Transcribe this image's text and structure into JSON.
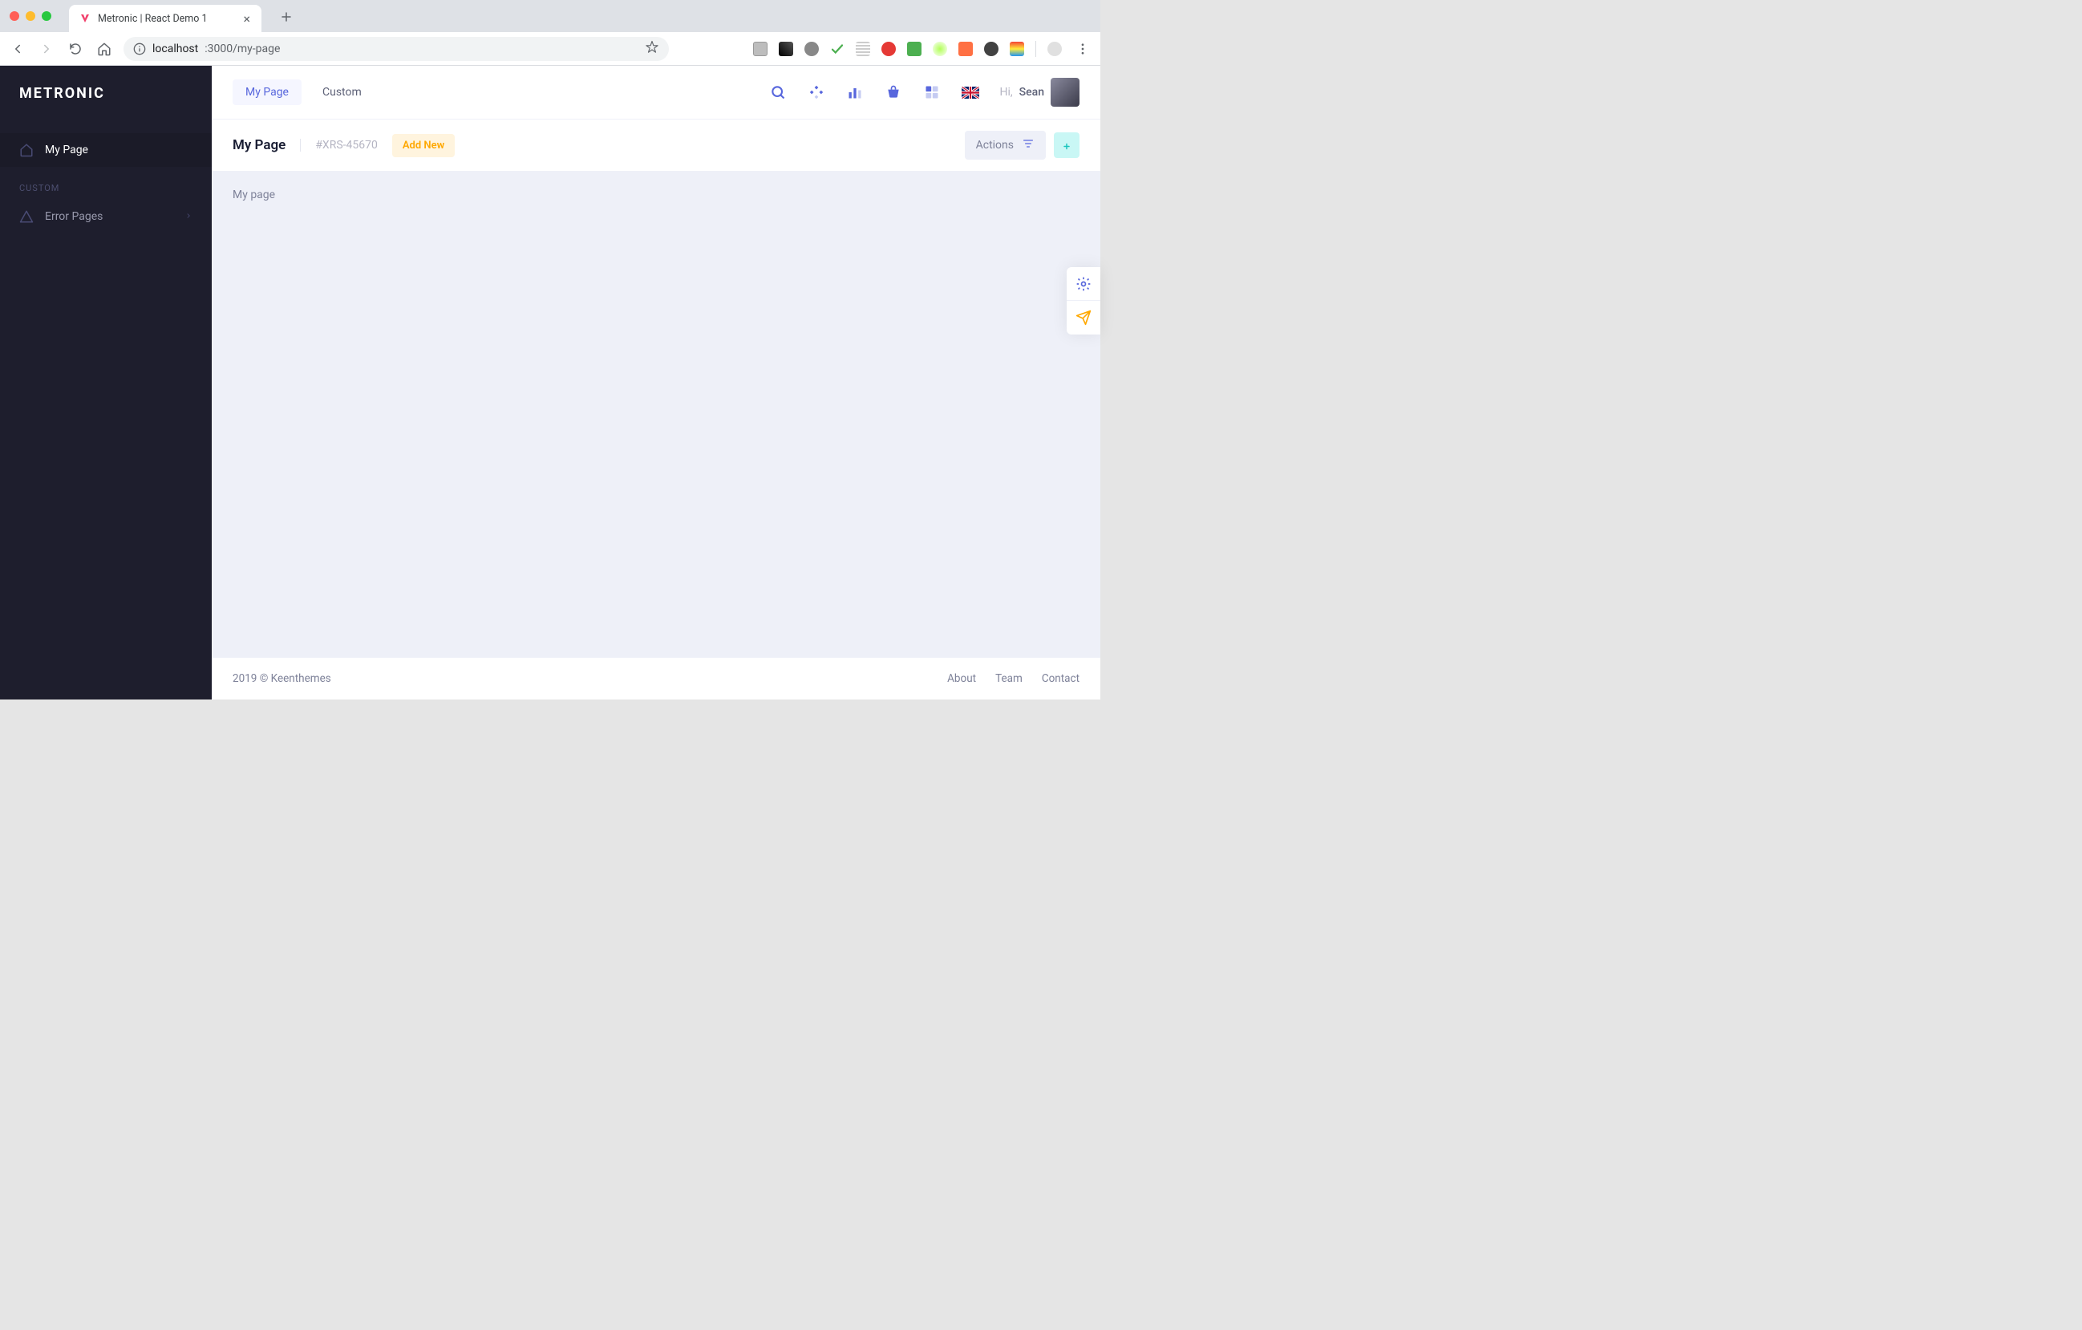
{
  "browser": {
    "tab_title": "Metronic | React Demo 1",
    "url_host": "localhost",
    "url_path": ":3000/my-page"
  },
  "sidebar": {
    "brand": "METRONIC",
    "items": [
      {
        "label": "My Page"
      }
    ],
    "section_label": "CUSTOM",
    "sub_items": [
      {
        "label": "Error Pages"
      }
    ]
  },
  "topbar": {
    "tabs": [
      {
        "label": "My Page"
      },
      {
        "label": "Custom"
      }
    ],
    "greet_hi": "Hi,",
    "greet_name": "Sean"
  },
  "subheader": {
    "title": "My Page",
    "id": "#XRS-45670",
    "add_new": "Add New",
    "actions": "Actions"
  },
  "content": {
    "body_text": "My page"
  },
  "footer": {
    "copyright": "2019 © Keenthemes",
    "links": [
      "About",
      "Team",
      "Contact"
    ]
  }
}
